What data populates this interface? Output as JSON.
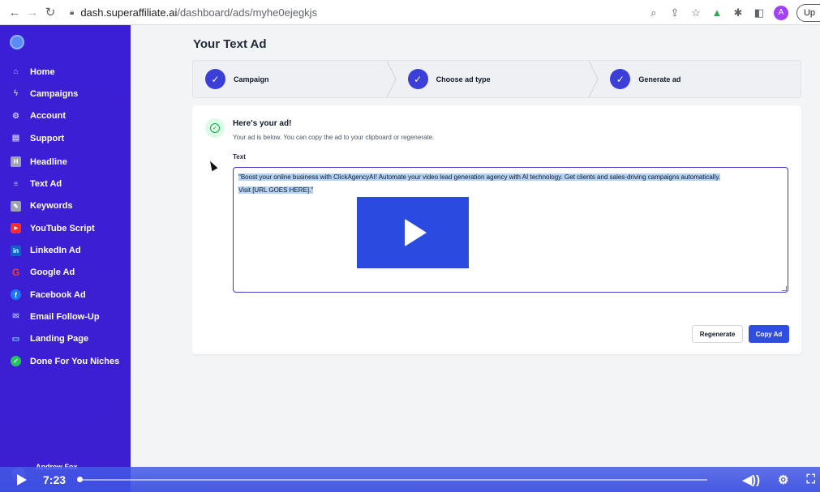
{
  "browser": {
    "url_host": "dash.superaffiliate.ai",
    "url_path": "/dashboard/ads/myhe0ejegkjs",
    "profile_initial": "A",
    "update_label": "Up"
  },
  "sidebar": {
    "items": [
      {
        "label": "Home",
        "icon": "home-icon"
      },
      {
        "label": "Campaigns",
        "icon": "bolt-icon"
      },
      {
        "label": "Account",
        "icon": "gear-icon"
      },
      {
        "label": "Support",
        "icon": "chat-icon"
      },
      {
        "label": "Headline",
        "icon": "headline-icon"
      },
      {
        "label": "Text Ad",
        "icon": "lines-icon"
      },
      {
        "label": "Keywords",
        "icon": "keywords-icon"
      },
      {
        "label": "YouTube Script",
        "icon": "youtube-icon"
      },
      {
        "label": "LinkedIn Ad",
        "icon": "linkedin-icon"
      },
      {
        "label": "Google Ad",
        "icon": "google-icon"
      },
      {
        "label": "Facebook Ad",
        "icon": "facebook-icon"
      },
      {
        "label": "Email Follow-Up",
        "icon": "email-icon"
      },
      {
        "label": "Landing Page",
        "icon": "landing-page-icon"
      },
      {
        "label": "Done For You Niches",
        "icon": "check-circle-icon"
      }
    ],
    "user_name": "Andrew Fox"
  },
  "page": {
    "title": "Your Text Ad",
    "steps": [
      {
        "label": "Campaign"
      },
      {
        "label": "Choose ad type"
      },
      {
        "label": "Generate ad"
      }
    ]
  },
  "card": {
    "title": "Here's your ad!",
    "subtitle": "Your ad is below. You can copy the ad to your clipboard or regenerate.",
    "field_label": "Text",
    "ad_line1": "\"Boost your online business with ClickAgencyAI! Automate your video lead generation agency with AI technology. Get clients and sales-driving campaigns automatically.",
    "ad_line2": "Visit [URL GOES HERE].\"",
    "regenerate_label": "Regenerate",
    "copy_label": "Copy Ad"
  },
  "video": {
    "time": "7:23",
    "progress": 0.0
  },
  "colors": {
    "sidebar": "#3b1fd6",
    "accent": "#2f4ee0",
    "step_check": "#3b3fd8",
    "success": "#16a34a"
  }
}
